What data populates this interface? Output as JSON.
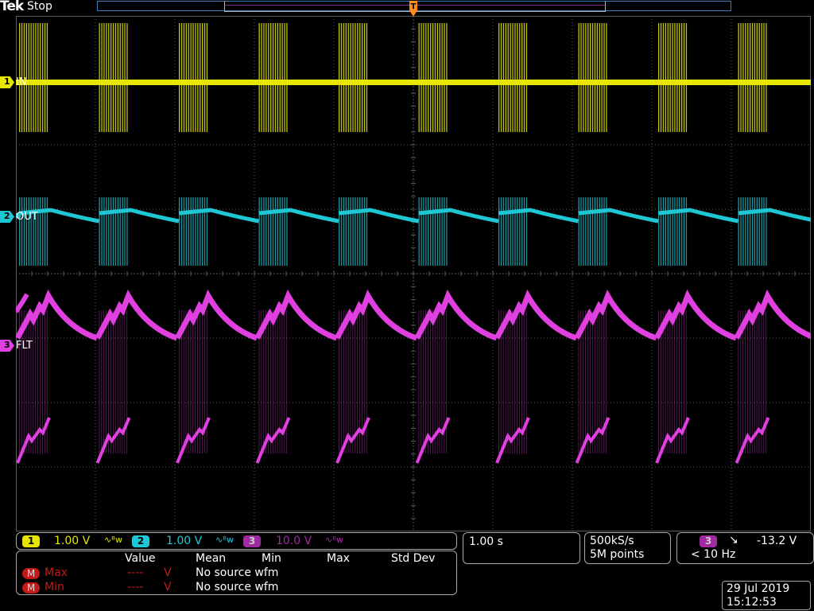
{
  "header": {
    "logo": "Tek",
    "acq_status": "Stop",
    "trigger_marker": "T"
  },
  "channels": [
    {
      "number": "1",
      "label": "IN",
      "color": "#e6e600",
      "scale": "1.00 V"
    },
    {
      "number": "2",
      "label": "OUT",
      "color": "#1fc7d4",
      "scale": "1.00 V"
    },
    {
      "number": "3",
      "label": "FLT",
      "color": "#e040e0",
      "scale": "10.0 V"
    }
  ],
  "coupling_symbol": "∿ᴮw",
  "measurements": {
    "headers": [
      "Value",
      "Mean",
      "Min",
      "Max",
      "Std Dev"
    ],
    "rows": [
      {
        "badge": "M",
        "name": "Max",
        "value": "----",
        "unit": "V",
        "note": "No source wfm"
      },
      {
        "badge": "M",
        "name": "Min",
        "value": "----",
        "unit": "V",
        "note": "No source wfm"
      }
    ]
  },
  "timebase": {
    "scale": "1.00 s"
  },
  "acquisition": {
    "sample_rate": "500kS/s",
    "record_length": "5M points"
  },
  "trigger": {
    "source": "3",
    "slope_symbol": "↘",
    "level": "-13.2 V",
    "frequency": "< 10 Hz"
  },
  "datetime": {
    "date": "29 Jul  2019",
    "time": "15:12:53"
  },
  "colors": {
    "grid": "#5a5a5a",
    "panel_border": "#a8a8a8",
    "trigger_marker": "#ff8c1a",
    "record_bar": "#3a7fc0"
  }
}
